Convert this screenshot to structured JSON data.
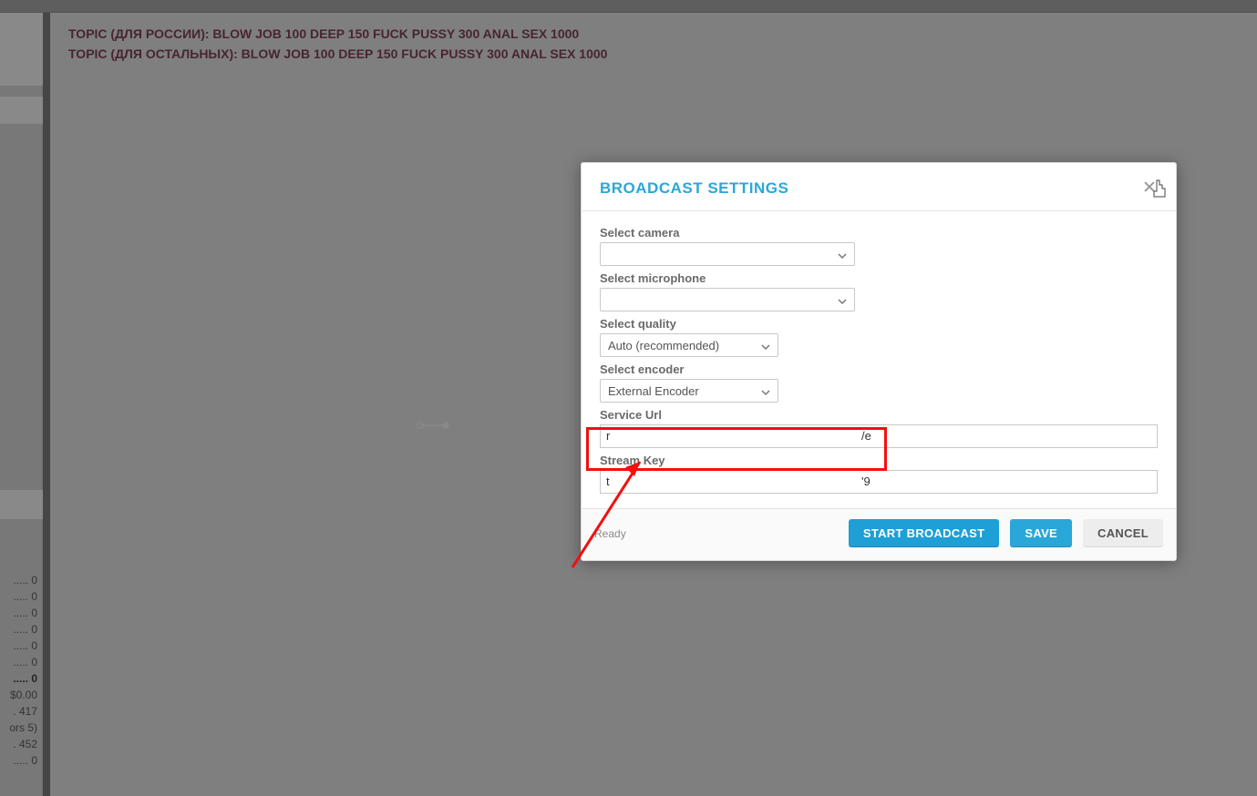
{
  "topics": {
    "line1": "TOPIC (ДЛЯ РОССИИ): BLOW JOB 100 DEEP 150 FUCK PUSSY 300 ANAL SEX 1000",
    "line2": "TOPIC (ДЛЯ ОСТАЛЬНЫХ): BLOW JOB 100 DEEP 150 FUCK PUSSY 300 ANAL SEX 1000"
  },
  "sidebar_stats": {
    "r0": "..... 0",
    "r1": "..... 0",
    "r2": "..... 0",
    "r3": "..... 0",
    "r4": "..... 0",
    "r5": "..... 0",
    "r6_bold": "..... 0",
    "r7": "$0.00",
    "r8": ". 417",
    "r9": "ors 5)",
    "r10": ". 452",
    "r11": "..... 0"
  },
  "modal": {
    "title": "BROADCAST SETTINGS",
    "labels": {
      "camera": "Select camera",
      "mic": "Select microphone",
      "quality": "Select quality",
      "encoder": "Select encoder",
      "service_url": "Service Url",
      "stream_key": "Stream Key"
    },
    "values": {
      "camera": "",
      "mic": "",
      "quality": "Auto (recommended)",
      "encoder": "External Encoder",
      "service_url_left": "r",
      "service_url_right": "/e",
      "stream_key_left": "t",
      "stream_key_right": "'9"
    },
    "footer": {
      "status": "Ready",
      "start": "START BROADCAST",
      "save": "SAVE",
      "cancel": "CANCEL"
    }
  },
  "colors": {
    "accent": "#2aa7d9",
    "annotation_red": "#f40e0e"
  }
}
